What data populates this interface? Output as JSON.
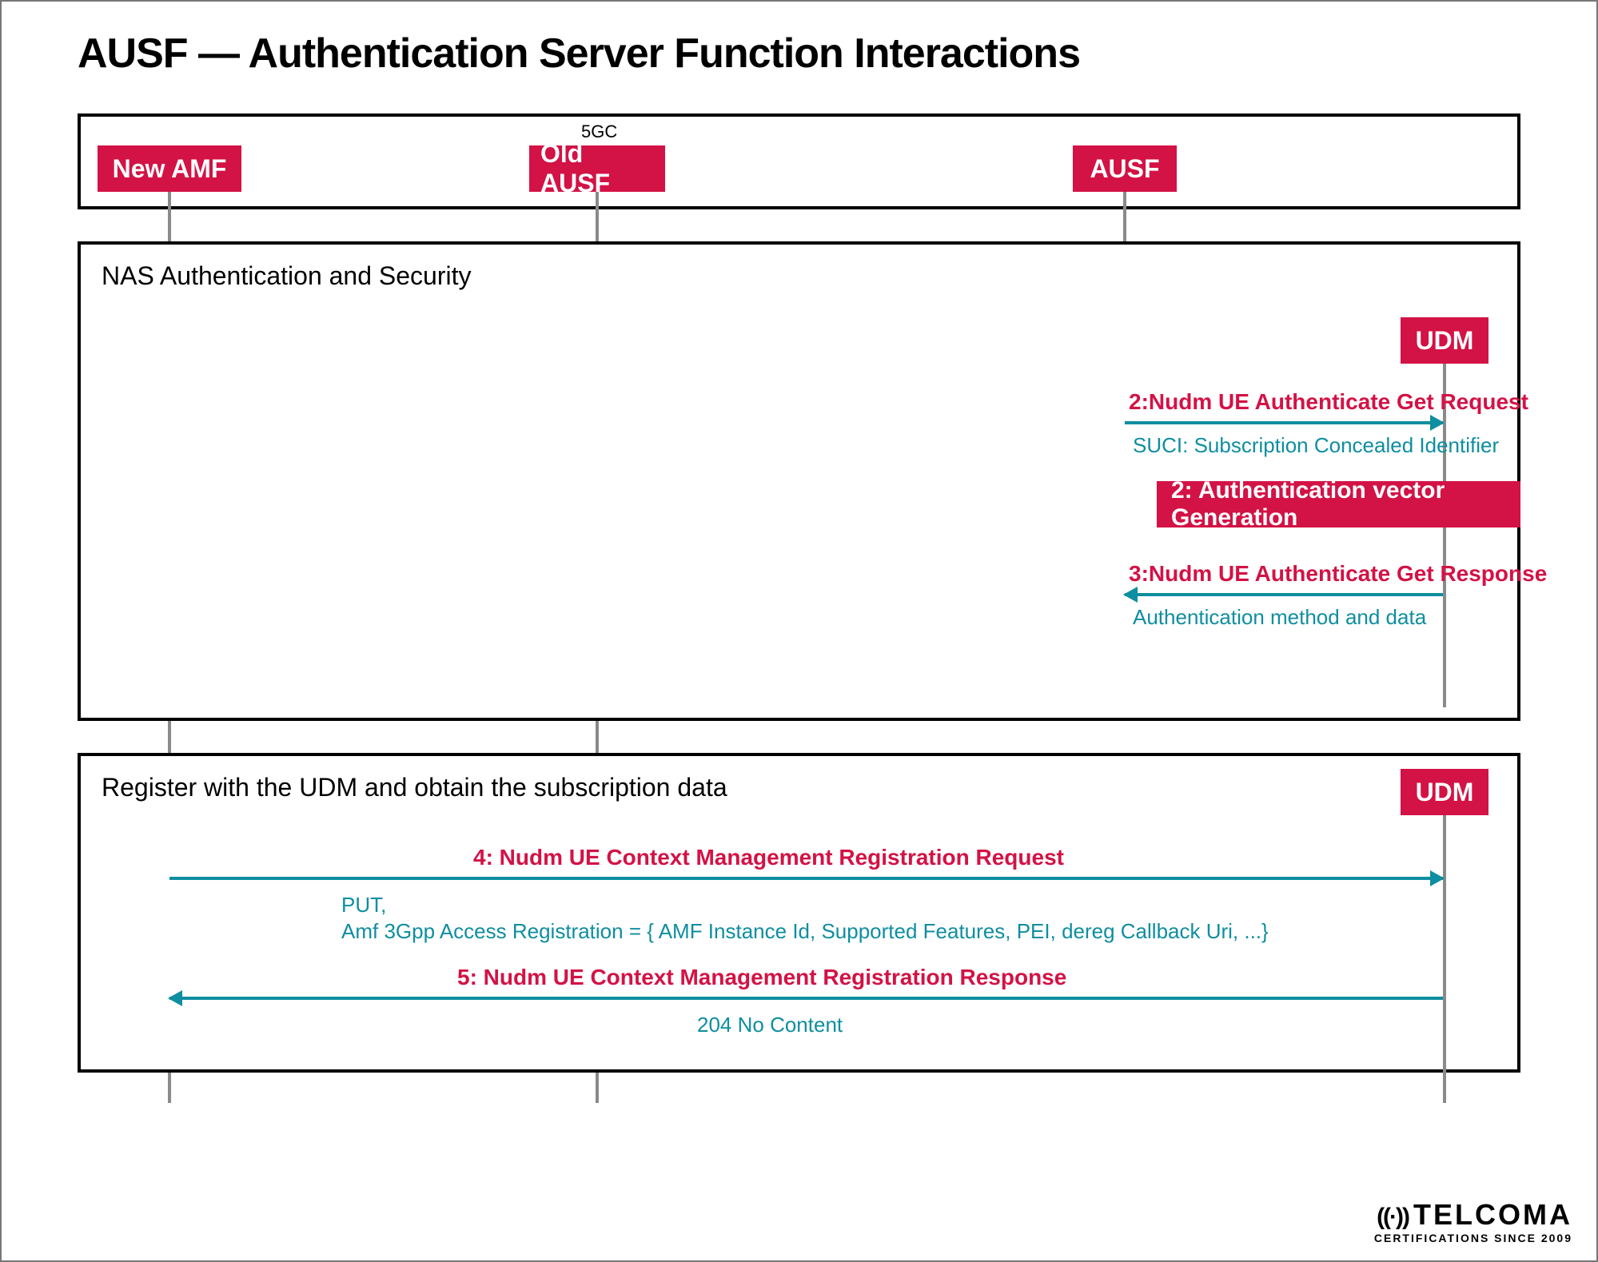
{
  "title": "AUSF — Authentication Server Function Interactions",
  "container": {
    "label": "5GC"
  },
  "actors": {
    "new_amf": "New AMF",
    "old_ausf": "Old AUSF",
    "ausf": "AUSF",
    "udm1": "UDM",
    "udm2": "UDM"
  },
  "sections": {
    "nas": {
      "title": "NAS Authentication and Security"
    },
    "reg": {
      "title": "Register with the UDM and obtain the subscription data"
    }
  },
  "messages": {
    "m2req": {
      "title": "2:Nudm UE Authenticate Get Request",
      "sub": "SUCI: Subscription Concealed Identifier"
    },
    "m2vec": {
      "title": "2: Authentication vector Generation"
    },
    "m3": {
      "title": "3:Nudm UE Authenticate Get Response",
      "sub": "Authentication method and data"
    },
    "m4": {
      "title": "4: Nudm UE Context Management Registration Request",
      "sub1": "PUT,",
      "sub2": "Amf 3Gpp Access Registration = { AMF Instance Id, Supported Features, PEI, dereg Callback Uri, ...}"
    },
    "m5": {
      "title": "5: Nudm UE Context Management Registration Response",
      "sub": "204 No Content"
    }
  },
  "logo": {
    "brand": "TELCOMA",
    "sub": "CERTIFICATIONS SINCE 2009",
    "sig": "((·))"
  }
}
